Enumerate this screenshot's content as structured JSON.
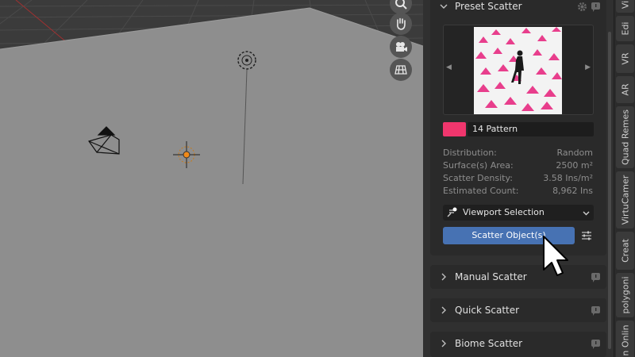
{
  "panels": {
    "preset": {
      "title": "Preset Scatter",
      "pattern_name": "14 Pattern",
      "swatch_color": "#f0366d",
      "stats": [
        {
          "label": "Distribution:",
          "value": "Random"
        },
        {
          "label": "Surface(s) Area:",
          "value": "2500 m²"
        },
        {
          "label": "Scatter Density:",
          "value": "3.58 Ins/m²"
        },
        {
          "label": "Estimated Count:",
          "value": "8,962 Ins"
        }
      ],
      "selection_dropdown": "Viewport Selection",
      "scatter_button": "Scatter Object(s)"
    },
    "manual": {
      "title": "Manual Scatter"
    },
    "quick": {
      "title": "Quick Scatter"
    },
    "biome": {
      "title": "Biome Scatter"
    }
  },
  "tabs": [
    "Vi",
    "Edi",
    "VR",
    "AR",
    "Quad Remes",
    "VirtuCamer",
    "Creat",
    "polygoni",
    "n Onlin"
  ],
  "colors": {
    "accent_button": "#4772b3",
    "viewport_bg": "#8e8e8e",
    "panel_bg": "#2a2a2a"
  },
  "icons": {
    "nav": [
      "zoom-icon",
      "hand-pan-icon",
      "camera-view-icon",
      "grid-ortho-icon"
    ],
    "panel_header": [
      "gear-icon",
      "info-icon"
    ]
  }
}
